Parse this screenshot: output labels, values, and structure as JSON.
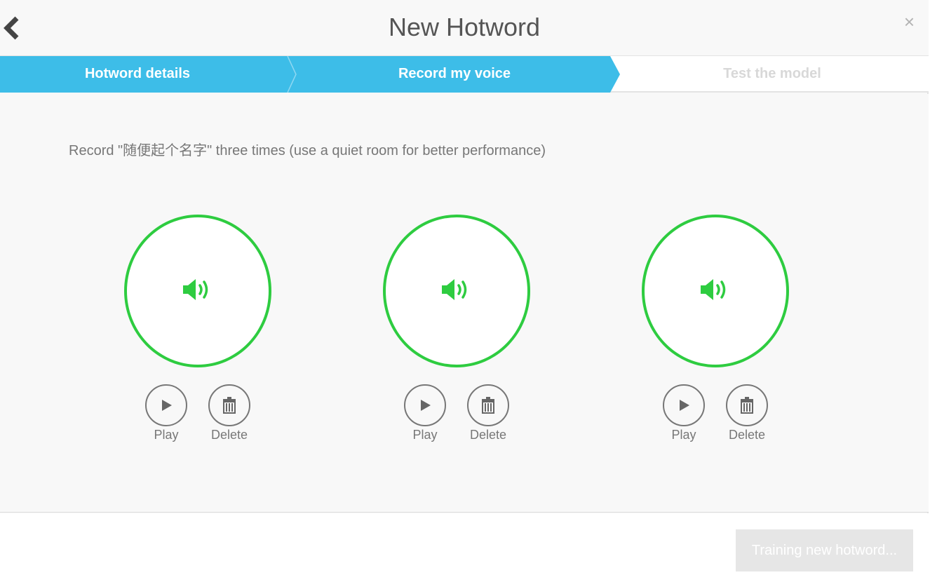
{
  "header": {
    "title": "New Hotword",
    "back_icon": "chevron-left-icon",
    "close_label": "×"
  },
  "steps": [
    {
      "label": "Hotword details",
      "state": "completed"
    },
    {
      "label": "Record my voice",
      "state": "active"
    },
    {
      "label": "Test the model",
      "state": "inactive"
    }
  ],
  "instruction": "Record \"随便起个名字\" three times (use a quiet room for better performance)",
  "recordings": [
    {
      "status_icon": "speaker-icon",
      "play_label": "Play",
      "delete_label": "Delete"
    },
    {
      "status_icon": "speaker-icon",
      "play_label": "Play",
      "delete_label": "Delete"
    },
    {
      "status_icon": "speaker-icon",
      "play_label": "Play",
      "delete_label": "Delete"
    }
  ],
  "footer": {
    "train_button_label": "Training new hotword...",
    "train_button_state": "disabled"
  },
  "colors": {
    "accent": "#3dbde8",
    "recorded": "#2ecc40",
    "disabled": "#e6e6e6"
  }
}
